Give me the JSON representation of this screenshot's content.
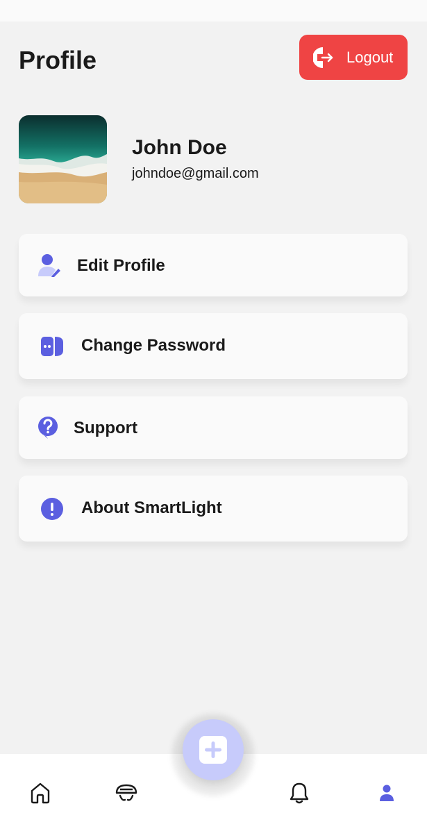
{
  "header": {
    "title": "Profile",
    "logout_label": "Logout"
  },
  "user": {
    "name": "John Doe",
    "email": "johndoe@gmail.com"
  },
  "menu": [
    {
      "label": "Edit Profile",
      "icon": "user-edit-icon"
    },
    {
      "label": "Change Password",
      "icon": "password-icon"
    },
    {
      "label": "Support",
      "icon": "help-icon"
    },
    {
      "label": "About SmartLight",
      "icon": "info-icon"
    }
  ],
  "bottom_nav": [
    {
      "icon": "home-icon",
      "active": false
    },
    {
      "icon": "lamp-icon",
      "active": false
    },
    {
      "icon": "add-icon",
      "active": false
    },
    {
      "icon": "bell-icon",
      "active": false
    },
    {
      "icon": "user-icon",
      "active": true
    }
  ],
  "colors": {
    "accent": "#5b5fe0",
    "logout": "#ef4444",
    "fab": "#c7cbfb",
    "background": "#f2f2f2",
    "card": "#fafafa"
  }
}
